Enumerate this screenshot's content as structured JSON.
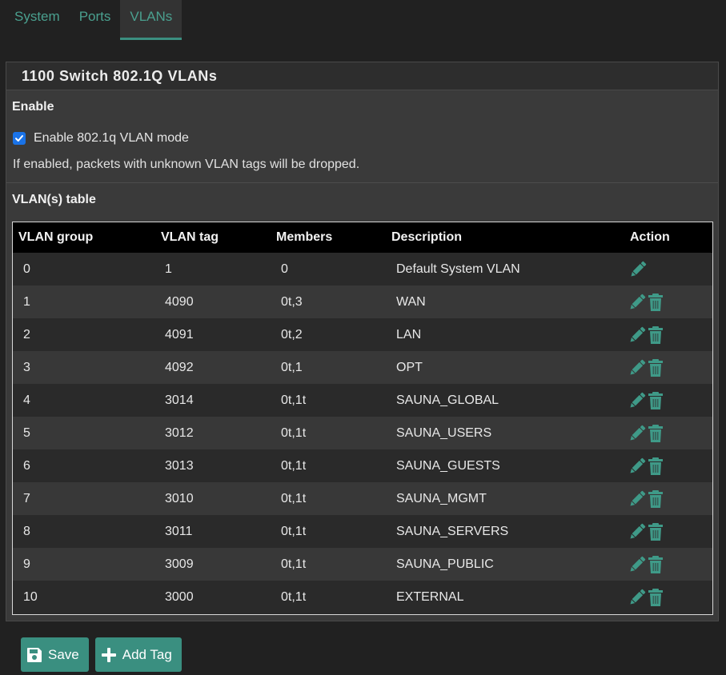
{
  "tabs": [
    {
      "label": "System",
      "active": false
    },
    {
      "label": "Ports",
      "active": false
    },
    {
      "label": "VLANs",
      "active": true
    }
  ],
  "panel": {
    "title": "1100 Switch 802.1Q VLANs",
    "enable_section": "Enable",
    "checkbox_label": "Enable 802.1q VLAN mode",
    "checkbox_checked": true,
    "help_text": "If enabled, packets with unknown VLAN tags will be dropped.",
    "table_section": "VLAN(s) table"
  },
  "table": {
    "headers": [
      "VLAN group",
      "VLAN tag",
      "Members",
      "Description",
      "Action"
    ],
    "rows": [
      {
        "group": "0",
        "tag": "1",
        "members": "0",
        "description": "Default System VLAN",
        "deletable": false
      },
      {
        "group": "1",
        "tag": "4090",
        "members": "0t,3",
        "description": "WAN",
        "deletable": true
      },
      {
        "group": "2",
        "tag": "4091",
        "members": "0t,2",
        "description": "LAN",
        "deletable": true
      },
      {
        "group": "3",
        "tag": "4092",
        "members": "0t,1",
        "description": "OPT",
        "deletable": true
      },
      {
        "group": "4",
        "tag": "3014",
        "members": "0t,1t",
        "description": "SAUNA_GLOBAL",
        "deletable": true
      },
      {
        "group": "5",
        "tag": "3012",
        "members": "0t,1t",
        "description": "SAUNA_USERS",
        "deletable": true
      },
      {
        "group": "6",
        "tag": "3013",
        "members": "0t,1t",
        "description": "SAUNA_GUESTS",
        "deletable": true
      },
      {
        "group": "7",
        "tag": "3010",
        "members": "0t,1t",
        "description": "SAUNA_MGMT",
        "deletable": true
      },
      {
        "group": "8",
        "tag": "3011",
        "members": "0t,1t",
        "description": "SAUNA_SERVERS",
        "deletable": true
      },
      {
        "group": "9",
        "tag": "3009",
        "members": "0t,1t",
        "description": "SAUNA_PUBLIC",
        "deletable": true
      },
      {
        "group": "10",
        "tag": "3000",
        "members": "0t,1t",
        "description": "EXTERNAL",
        "deletable": true
      }
    ]
  },
  "buttons": {
    "save_label": "Save",
    "add_tag_label": "Add Tag"
  },
  "icons": {
    "edit": "pencil-icon",
    "delete": "trash-icon",
    "save": "floppy-disk-icon",
    "add": "plus-icon"
  },
  "colors": {
    "accent": "#3a8f80",
    "icon": "#3f9a88",
    "checkbox": "#1a73e8"
  }
}
